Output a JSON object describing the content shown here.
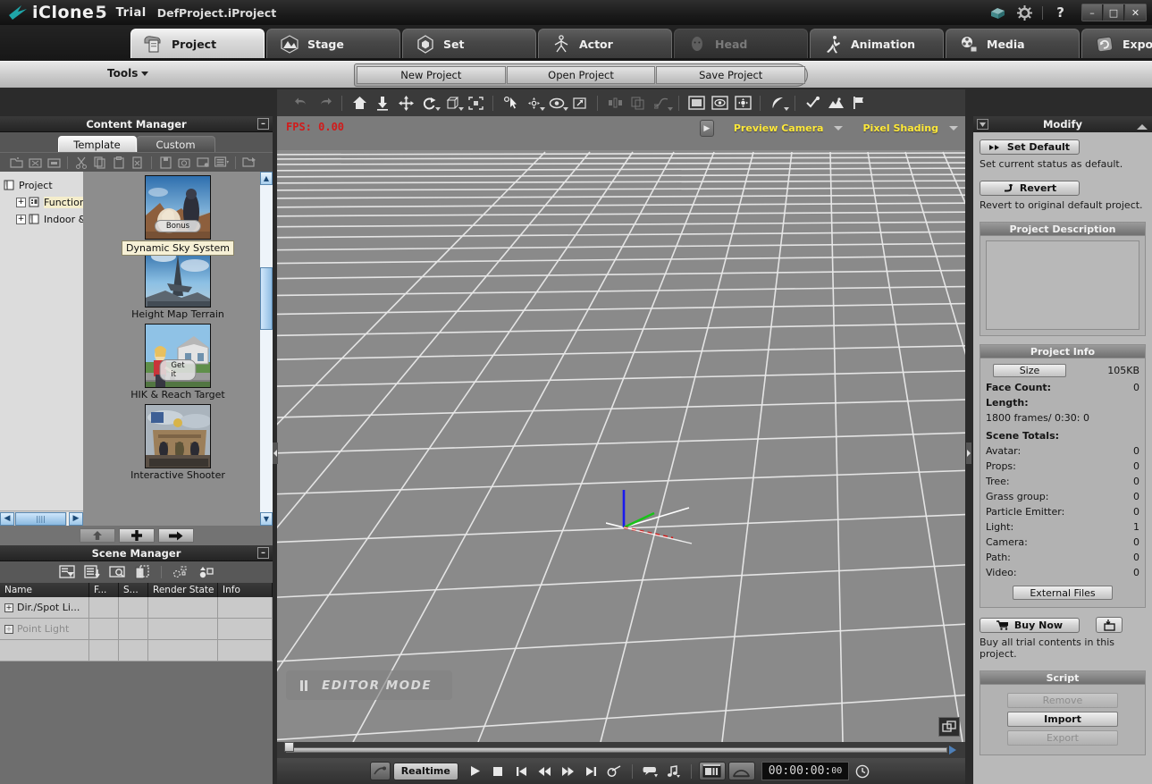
{
  "titlebar": {
    "brand": "iClone",
    "brand_num": "5",
    "edition": "Trial",
    "project_name": "DefProject.iProject",
    "help_glyph": "?",
    "minimize": "–",
    "maximize": "□",
    "close": "✕"
  },
  "tabs": [
    {
      "label": "Project",
      "icon": "project-icon",
      "state": "active"
    },
    {
      "label": "Stage",
      "icon": "stage-icon",
      "state": "normal"
    },
    {
      "label": "Set",
      "icon": "set-icon",
      "state": "normal"
    },
    {
      "label": "Actor",
      "icon": "actor-icon",
      "state": "normal"
    },
    {
      "label": "Head",
      "icon": "head-icon",
      "state": "disabled"
    },
    {
      "label": "Animation",
      "icon": "animation-icon",
      "state": "normal"
    },
    {
      "label": "Media",
      "icon": "media-icon",
      "state": "normal"
    },
    {
      "label": "Export",
      "icon": "export-icon",
      "state": "normal"
    }
  ],
  "tools_row": {
    "tools_label": "Tools",
    "buttons": [
      "New Project",
      "Open Project",
      "Save Project"
    ]
  },
  "content_manager": {
    "title": "Content Manager",
    "collapse_glyph": "–",
    "tabs": [
      {
        "label": "Template",
        "active": true
      },
      {
        "label": "Custom",
        "active": false
      }
    ],
    "tree": [
      {
        "label": "Project",
        "level": 0,
        "selected": false
      },
      {
        "label": "Functiona",
        "level": 1,
        "selected": true
      },
      {
        "label": "Indoor & ",
        "level": 1,
        "selected": false
      }
    ],
    "items": [
      {
        "label": "Dynamic Sky System",
        "badge": "Bonus",
        "tooltip": true
      },
      {
        "label": "Height Map Terrain",
        "badge": "",
        "tooltip": false
      },
      {
        "label": "HIK & Reach Target",
        "badge": "Get it",
        "tooltip": false
      },
      {
        "label": "Interactive Shooter",
        "badge": "",
        "tooltip": false
      }
    ],
    "footer_buttons": [
      "apply-up",
      "add",
      "send-right"
    ]
  },
  "scene_manager": {
    "title": "Scene Manager",
    "collapse_glyph": "–",
    "columns": [
      "Name",
      "F...",
      "S...",
      "Render State",
      "Info"
    ],
    "rows": [
      {
        "name": "Dir./Spot Li...",
        "f": "",
        "s": "",
        "render_state": "",
        "info": "",
        "dim": false
      },
      {
        "name": "Point Light",
        "f": "",
        "s": "",
        "render_state": "",
        "info": "",
        "dim": true
      },
      {
        "name": "",
        "f": "",
        "s": "",
        "render_state": "",
        "info": "",
        "dim": false
      }
    ]
  },
  "viewport": {
    "fps": "FPS: 0.00",
    "camera_label": "Preview Camera",
    "shading_label": "Pixel Shading",
    "editor_mode": "EDITOR MODE",
    "grid_color": "#e8e8e8",
    "bg_color": "#8a8a8a"
  },
  "transport": {
    "realtime_label": "Realtime",
    "timecode": "00:00:00",
    "timecode_frames": "00",
    "buttons": [
      "render-preview",
      "play",
      "stop",
      "first-frame",
      "rewind",
      "fast-forward",
      "last-frame",
      "loop",
      "speech",
      "audio",
      "screen-capture",
      "render-arc",
      "clock"
    ]
  },
  "modify": {
    "title": "Modify",
    "set_default_label": "Set Default",
    "set_default_note": "Set current status as default.",
    "revert_label": "Revert",
    "revert_note": "Revert to original default project.",
    "project_description_title": "Project Description",
    "project_description_text": "",
    "project_info_title": "Project Info",
    "size_label": "Size",
    "size_value": "105KB",
    "face_count_label": "Face Count:",
    "face_count_value": "0",
    "length_label": "Length:",
    "length_value": "1800 frames/ 0:30: 0",
    "scene_totals_label": "Scene Totals:",
    "scene_totals": [
      {
        "label": "Avatar:",
        "value": "0"
      },
      {
        "label": "Props:",
        "value": "0"
      },
      {
        "label": "Tree:",
        "value": "0"
      },
      {
        "label": "Grass group:",
        "value": "0"
      },
      {
        "label": "Particle Emitter:",
        "value": "0"
      },
      {
        "label": "Light:",
        "value": "1"
      },
      {
        "label": "Camera:",
        "value": "0"
      },
      {
        "label": "Path:",
        "value": "0"
      },
      {
        "label": "Video:",
        "value": "0"
      }
    ],
    "external_files_label": "External Files",
    "buy_now_label": "Buy Now",
    "buy_note": "Buy all trial contents in this project.",
    "script_title": "Script",
    "script_buttons": [
      {
        "label": "Remove",
        "enabled": false
      },
      {
        "label": "Import",
        "enabled": true
      },
      {
        "label": "Export",
        "enabled": false
      }
    ]
  }
}
